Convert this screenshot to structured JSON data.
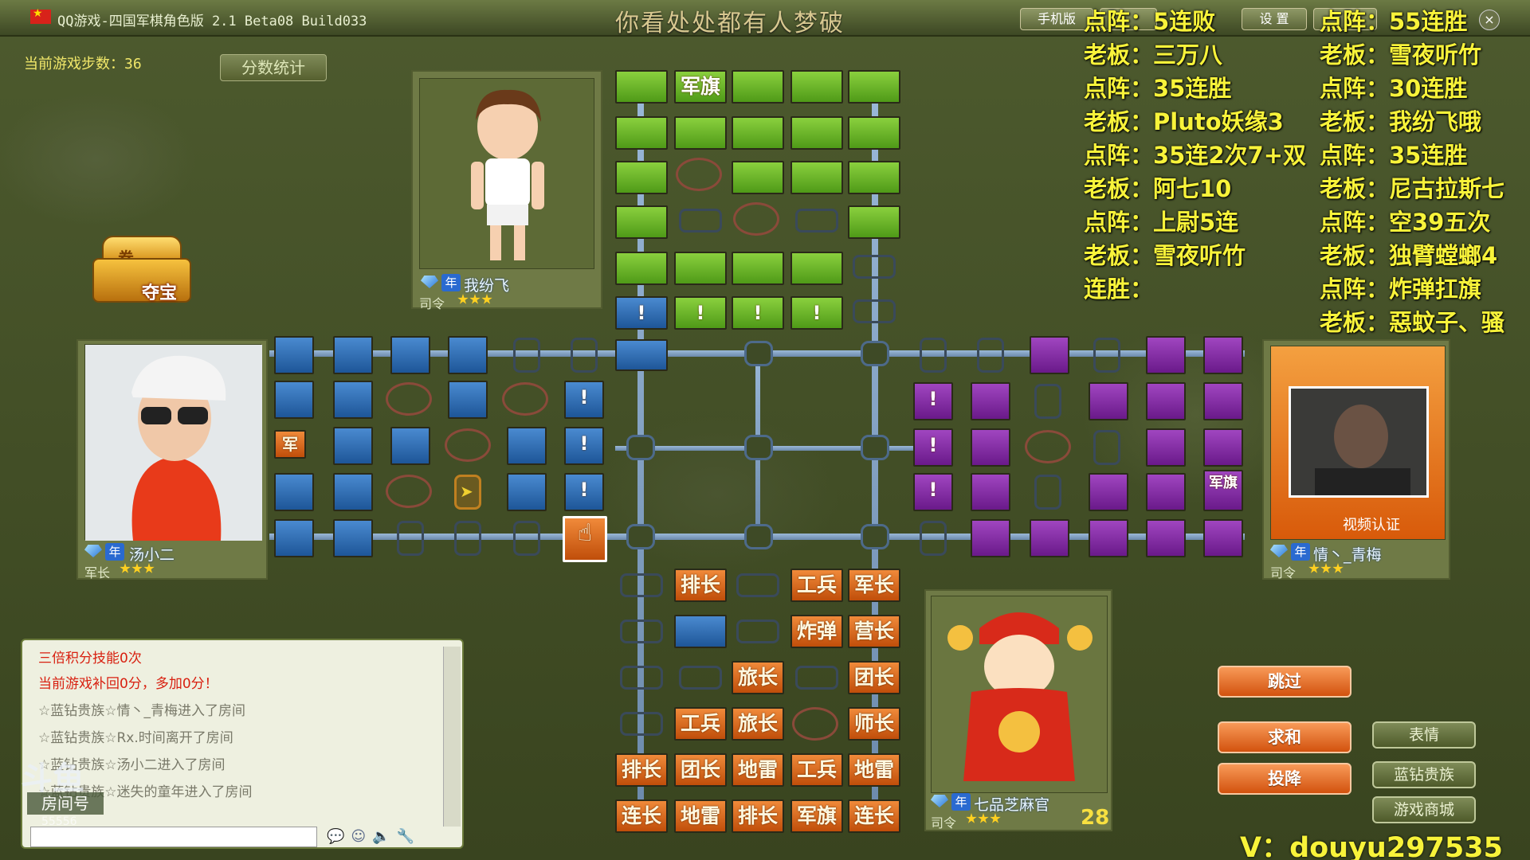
{
  "window": {
    "title": "QQ游戏-四国军棋角色版 2.1 Beta08 Build033",
    "slogan": "你看处处都有人梦破",
    "buttons": {
      "mobile": "手机版",
      "tab2": "",
      "settings": "设 置",
      "tab4": ""
    }
  },
  "game": {
    "steps_label": "当前游戏步数：",
    "steps_value": "36",
    "score_button": "分数统计",
    "treasure_label": "夺宝",
    "treasure_ticket": "券",
    "turn_count": "28"
  },
  "players": {
    "top": {
      "name": "我纷飞",
      "rank": "司令",
      "badge": "年"
    },
    "left": {
      "name": "汤小二",
      "rank": "军长",
      "badge": "年"
    },
    "right": {
      "name": "情丶_青梅",
      "rank": "司令",
      "badge": "年",
      "video_label": "视频认证"
    },
    "bottom": {
      "name": "七品芝麻官",
      "rank": "司令",
      "badge": "年"
    }
  },
  "board": {
    "top_flag": "军旗",
    "left_flag": "军",
    "right_flag": "军旗",
    "mark": "!",
    "bottom_pieces": {
      "r1": [
        "",
        "排长",
        "",
        "工兵",
        "军长"
      ],
      "r2": [
        "",
        "",
        "",
        "炸弹",
        "营长"
      ],
      "r3": [
        "",
        "",
        "旅长",
        "",
        "团长"
      ],
      "r4": [
        "",
        "工兵",
        "旅长",
        "",
        "师长"
      ],
      "r5": [
        "排长",
        "团长",
        "地雷",
        "工兵",
        "地雷"
      ],
      "r6": [
        "连长",
        "地雷",
        "排长",
        "军旗",
        "连长"
      ]
    }
  },
  "chat": {
    "lines": [
      "三倍积分技能0次",
      "当前游戏补回0分，多加0分！",
      "☆蓝钻贵族☆情丶_青梅进入了房间",
      "☆蓝钻贵族☆Rx.时间离开了房间",
      "☆蓝钻贵族☆汤小二进入了房间",
      "☆蓝钻贵族☆迷失的童年进入了房间"
    ],
    "room_logo": "斗鱼",
    "room_label": "房间号",
    "room_number": "55556"
  },
  "actions": {
    "skip": "跳过",
    "draw": "求和",
    "surrender": "投降",
    "emotion": "表情",
    "blue_diamond": "蓝钻贵族",
    "shop": "游戏商城"
  },
  "overlay": {
    "left": [
      "点阵：5连败",
      "老板：三万八",
      "点阵：35连胜",
      "老板：Pluto妖缘3",
      "点阵：35连2次7+双",
      "老板：阿七10",
      "点阵：上尉5连",
      "老板：雪夜听竹",
      "连胜："
    ],
    "right": [
      "点阵：55连胜",
      "老板：雪夜听竹",
      "点阵：30连胜",
      "老板：我纷飞哦",
      "点阵：35连胜",
      "老板：尼古拉斯七",
      "点阵：空39五次",
      "老板：独臂螳螂4",
      "点阵：炸弹扛旗",
      "老板：惡蚊子、骚"
    ],
    "watermark": "V：douyu297535"
  },
  "colors": {
    "yellow_text": "#f8f33a",
    "green_piece": "#6cb82a",
    "blue_piece": "#2a6ab0",
    "purple_piece": "#8a2aa8",
    "orange_piece": "#e06a1a"
  }
}
